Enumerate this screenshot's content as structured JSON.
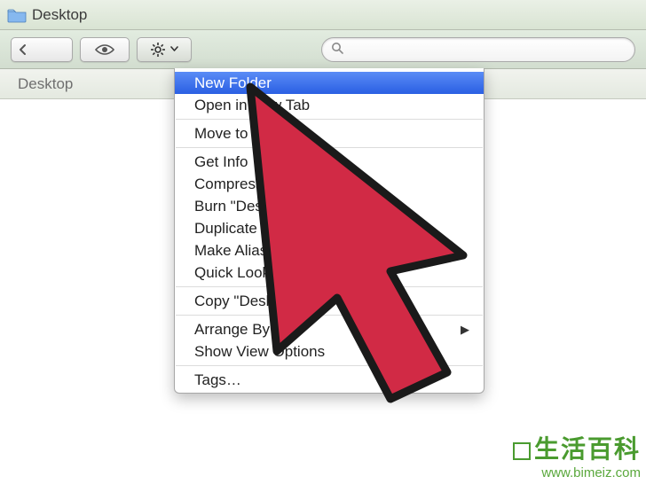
{
  "titlebar": {
    "title": "Desktop"
  },
  "pathbar": {
    "crumb": "Desktop"
  },
  "search": {
    "placeholder": ""
  },
  "menu": {
    "items": [
      "New Folder",
      "Open in New Tab",
      "Move to Trash",
      "Get Info",
      "Compress \"Desktop\"",
      "Burn \"Desktop\" to Disc…",
      "Duplicate",
      "Make Alias",
      "Quick Look \"Desktop\"",
      "Copy \"Desktop\"",
      "Arrange By",
      "Show View Options",
      "Tags…"
    ],
    "highlighted_index": 0,
    "submenu_index": 10
  },
  "watermark": {
    "cn": "生活百科",
    "url": "www.bimeiz.com"
  },
  "colors": {
    "highlight": "#3e72ea",
    "arrow_fill": "#d12a45",
    "arrow_stroke": "#1a1a1a"
  }
}
